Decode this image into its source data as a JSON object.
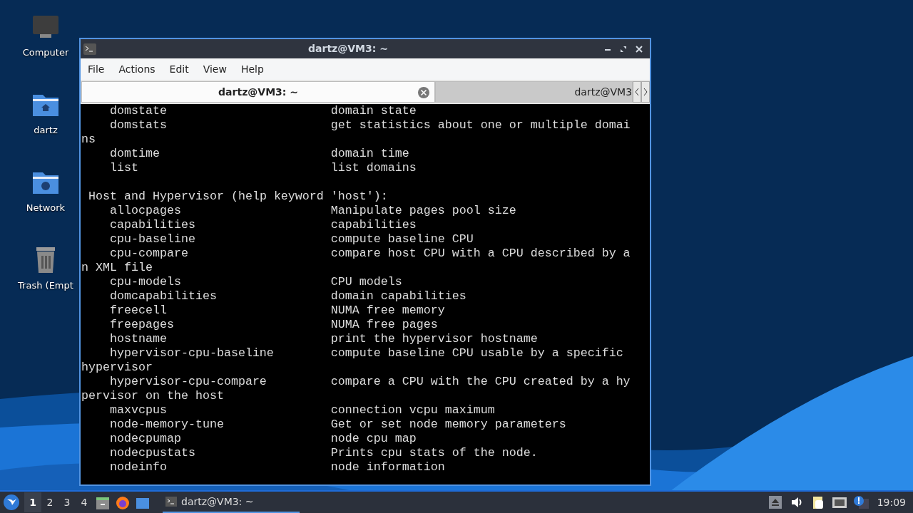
{
  "desktop_icons": [
    {
      "kind": "computer",
      "label": "Computer"
    },
    {
      "kind": "home",
      "label": "dartz"
    },
    {
      "kind": "network",
      "label": "Network"
    },
    {
      "kind": "trash",
      "label": "Trash (Empt"
    }
  ],
  "window": {
    "title": "dartz@VM3: ~",
    "menu": [
      "File",
      "Actions",
      "Edit",
      "View",
      "Help"
    ],
    "tabs": [
      {
        "label": "dartz@VM3: ~",
        "selected": true
      },
      {
        "label": "dartz@VM3",
        "selected": false
      }
    ],
    "terminal_lines": [
      {
        "kind": "entry",
        "command": "domstate",
        "description": "domain state"
      },
      {
        "kind": "entry",
        "command": "domstats",
        "description": "get statistics about one or multiple domai"
      },
      {
        "kind": "text",
        "text": "ns"
      },
      {
        "kind": "entry",
        "command": "domtime",
        "description": "domain time"
      },
      {
        "kind": "entry",
        "command": "list",
        "description": "list domains"
      },
      {
        "kind": "blank"
      },
      {
        "kind": "text",
        "text": " Host and Hypervisor (help keyword 'host'):"
      },
      {
        "kind": "entry",
        "command": "allocpages",
        "description": "Manipulate pages pool size"
      },
      {
        "kind": "entry",
        "command": "capabilities",
        "description": "capabilities"
      },
      {
        "kind": "entry",
        "command": "cpu-baseline",
        "description": "compute baseline CPU"
      },
      {
        "kind": "entry",
        "command": "cpu-compare",
        "description": "compare host CPU with a CPU described by a"
      },
      {
        "kind": "text",
        "text": "n XML file"
      },
      {
        "kind": "entry",
        "command": "cpu-models",
        "description": "CPU models"
      },
      {
        "kind": "entry",
        "command": "domcapabilities",
        "description": "domain capabilities"
      },
      {
        "kind": "entry",
        "command": "freecell",
        "description": "NUMA free memory"
      },
      {
        "kind": "entry",
        "command": "freepages",
        "description": "NUMA free pages"
      },
      {
        "kind": "entry",
        "command": "hostname",
        "description": "print the hypervisor hostname"
      },
      {
        "kind": "entry",
        "command": "hypervisor-cpu-baseline",
        "description": "compute baseline CPU usable by a specific"
      },
      {
        "kind": "text",
        "text": "hypervisor"
      },
      {
        "kind": "entry",
        "command": "hypervisor-cpu-compare",
        "description": "compare a CPU with the CPU created by a hy"
      },
      {
        "kind": "text",
        "text": "pervisor on the host"
      },
      {
        "kind": "entry",
        "command": "maxvcpus",
        "description": "connection vcpu maximum"
      },
      {
        "kind": "entry",
        "command": "node-memory-tune",
        "description": "Get or set node memory parameters"
      },
      {
        "kind": "entry",
        "command": "nodecpumap",
        "description": "node cpu map"
      },
      {
        "kind": "entry",
        "command": "nodecpustats",
        "description": "Prints cpu stats of the node."
      },
      {
        "kind": "entry",
        "command": "nodeinfo",
        "description": "node information"
      }
    ]
  },
  "taskbar": {
    "workspaces": [
      {
        "label": "1",
        "selected": true
      },
      {
        "label": "2",
        "selected": false
      },
      {
        "label": "3",
        "selected": false
      },
      {
        "label": "4",
        "selected": false
      }
    ],
    "tasks": [
      {
        "label": "dartz@VM3: ~",
        "selected": true
      }
    ],
    "clock": "19:09"
  }
}
